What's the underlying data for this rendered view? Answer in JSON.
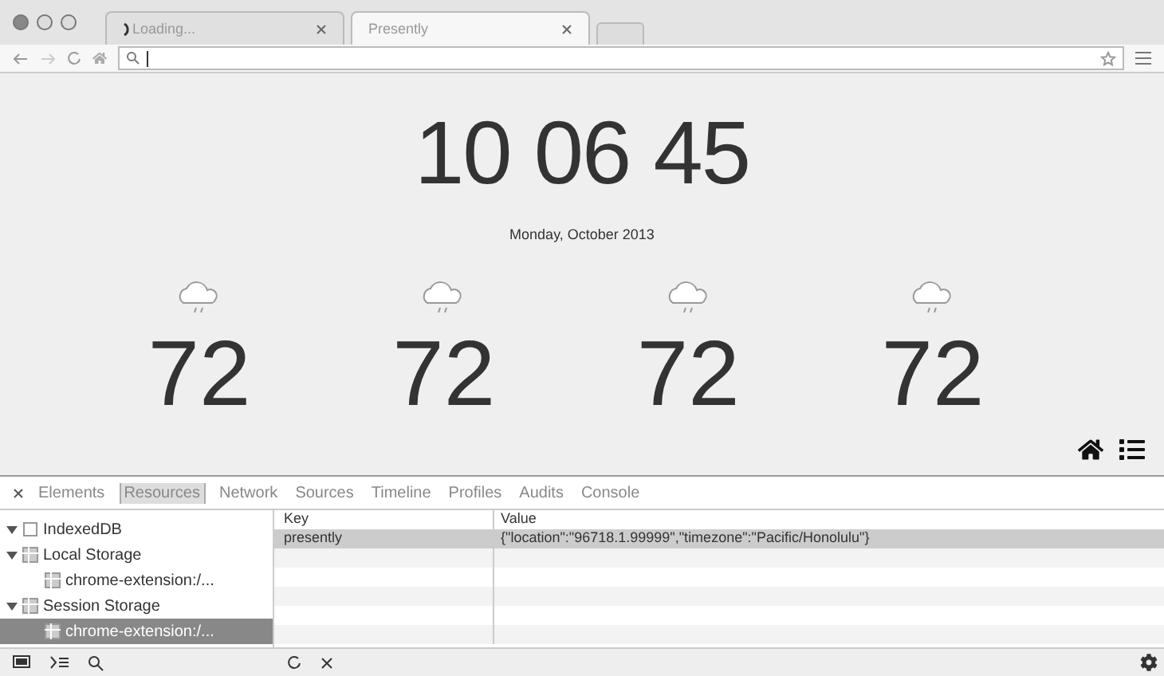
{
  "browser_tabs": [
    {
      "title": "Loading...",
      "loading": true,
      "selected": false
    },
    {
      "title": "Presently",
      "loading": false,
      "selected": true
    }
  ],
  "clock": {
    "time": "10 06 45",
    "date": "Monday, October 2013"
  },
  "forecast": [
    {
      "temperature": "72"
    },
    {
      "temperature": "72"
    },
    {
      "temperature": "72"
    },
    {
      "temperature": "72"
    }
  ],
  "devtools": {
    "tabs": [
      {
        "label": "Elements",
        "selected": false
      },
      {
        "label": "Resources",
        "selected": true
      },
      {
        "label": "Network",
        "selected": false
      },
      {
        "label": "Sources",
        "selected": false
      },
      {
        "label": "Timeline",
        "selected": false
      },
      {
        "label": "Profiles",
        "selected": false
      },
      {
        "label": "Audits",
        "selected": false
      },
      {
        "label": "Console",
        "selected": false
      }
    ],
    "tree": [
      {
        "label": "IndexedDB",
        "expanded": true,
        "selected": false,
        "kind": "database"
      },
      {
        "label": "Local Storage",
        "expanded": true,
        "selected": false,
        "kind": "storage",
        "children": [
          {
            "label": "chrome-extension:/...",
            "selected": false,
            "kind": "storage"
          }
        ]
      },
      {
        "label": "Session Storage",
        "expanded": true,
        "selected": false,
        "kind": "storage",
        "children": [
          {
            "label": "chrome-extension:/...",
            "selected": true,
            "kind": "storage"
          }
        ]
      }
    ],
    "table": {
      "columns": [
        "Key",
        "Value"
      ],
      "rows": [
        {
          "key": "presently",
          "value": "{\"location\":\"96718.1.99999\",\"timezone\":\"Pacific/Honolulu\"}",
          "selected": true
        }
      ]
    }
  }
}
